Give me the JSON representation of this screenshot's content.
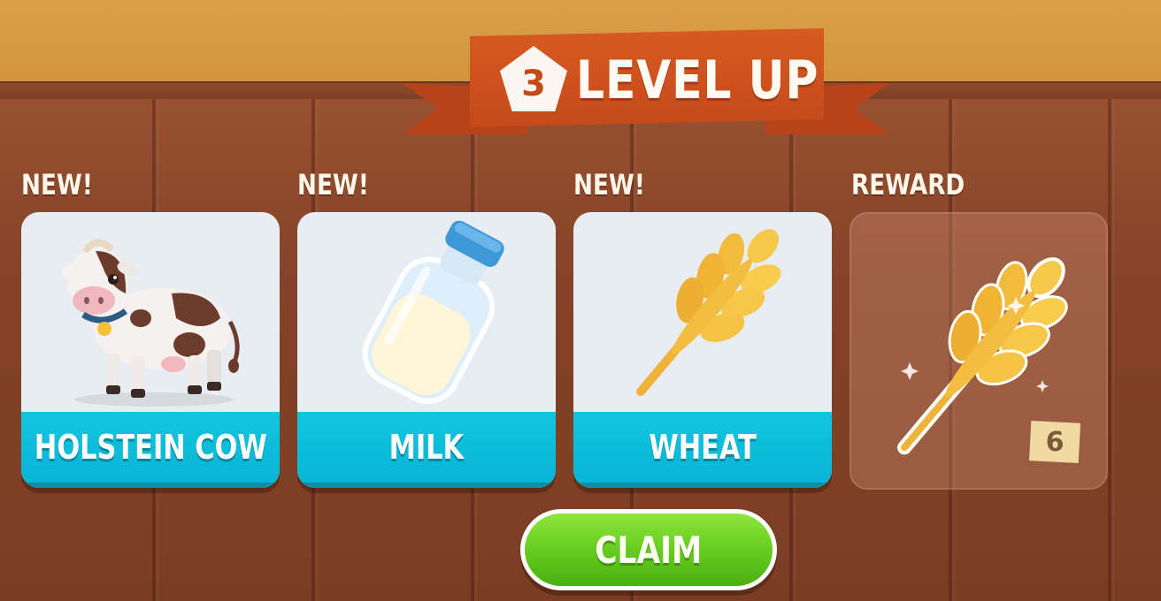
{
  "banner": {
    "level": "3",
    "title": "LEVEL UP"
  },
  "unlocks": [
    {
      "tag": "NEW!",
      "name": "HOLSTEIN COW",
      "icon": "cow-icon"
    },
    {
      "tag": "NEW!",
      "name": "MILK",
      "icon": "milk-bottle-icon"
    },
    {
      "tag": "NEW!",
      "name": "WHEAT",
      "icon": "wheat-icon"
    }
  ],
  "reward": {
    "tag": "REWARD",
    "icon": "wheat-icon",
    "quantity": "6"
  },
  "claim_label": "CLAIM",
  "colors": {
    "banner": "#c44a1a",
    "card_strip": "#06b5d4",
    "claim_button": "#5fc71c",
    "fence": "#844227",
    "sky": "#d49340"
  }
}
